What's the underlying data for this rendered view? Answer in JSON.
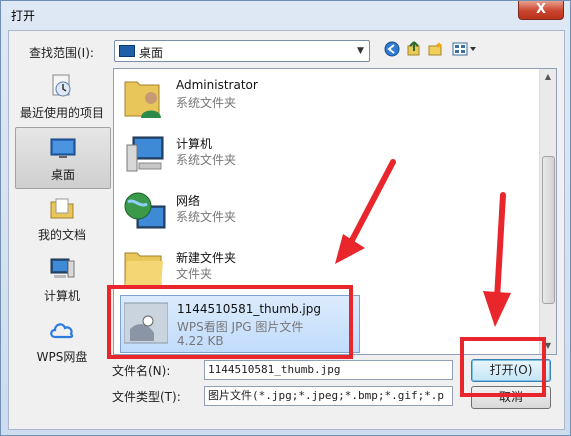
{
  "window": {
    "title": "打开",
    "close_glyph": "X"
  },
  "lookin": {
    "label": "查找范围(I):",
    "value": "桌面",
    "icon": "desktop-icon"
  },
  "toolbar": {
    "back": "back-icon",
    "up": "up-folder-icon",
    "new_folder": "new-folder-icon",
    "views": "views-menu-icon"
  },
  "places": [
    {
      "label": "最近使用的项目",
      "icon": "recent-icon",
      "selected": false
    },
    {
      "label": "桌面",
      "icon": "desktop-icon",
      "selected": true
    },
    {
      "label": "我的文档",
      "icon": "documents-icon",
      "selected": false
    },
    {
      "label": "计算机",
      "icon": "computer-icon",
      "selected": false
    },
    {
      "label": "WPS网盘",
      "icon": "cloud-icon",
      "selected": false
    }
  ],
  "files": [
    {
      "name": "Administrator",
      "type": "系统文件夹",
      "size": "",
      "icon": "user-folder-icon",
      "selected": false
    },
    {
      "name": "计算机",
      "type": "系统文件夹",
      "size": "",
      "icon": "computer-icon",
      "selected": false
    },
    {
      "name": "网络",
      "type": "系统文件夹",
      "size": "",
      "icon": "network-globe-icon",
      "selected": false
    },
    {
      "name": "新建文件夹",
      "type": "文件夹",
      "size": "",
      "icon": "folder-icon",
      "selected": false
    },
    {
      "name": "1144510581_thumb.jpg",
      "type": "WPS看图 JPG 图片文件",
      "size": "4.22 KB",
      "icon": "image-thumbnail-icon",
      "selected": true
    }
  ],
  "filename": {
    "label": "文件名(N):",
    "value": "1144510581_thumb.jpg"
  },
  "filetype": {
    "label": "文件类型(T):",
    "value": "图片文件(*.jpg;*.jpeg;*.bmp;*.gif;*.p"
  },
  "buttons": {
    "open": "打开(O)",
    "cancel": "取消"
  },
  "colors": {
    "highlight": "#e8262c",
    "selection": "#c1dcfc",
    "accent": "#1f5fa8"
  }
}
